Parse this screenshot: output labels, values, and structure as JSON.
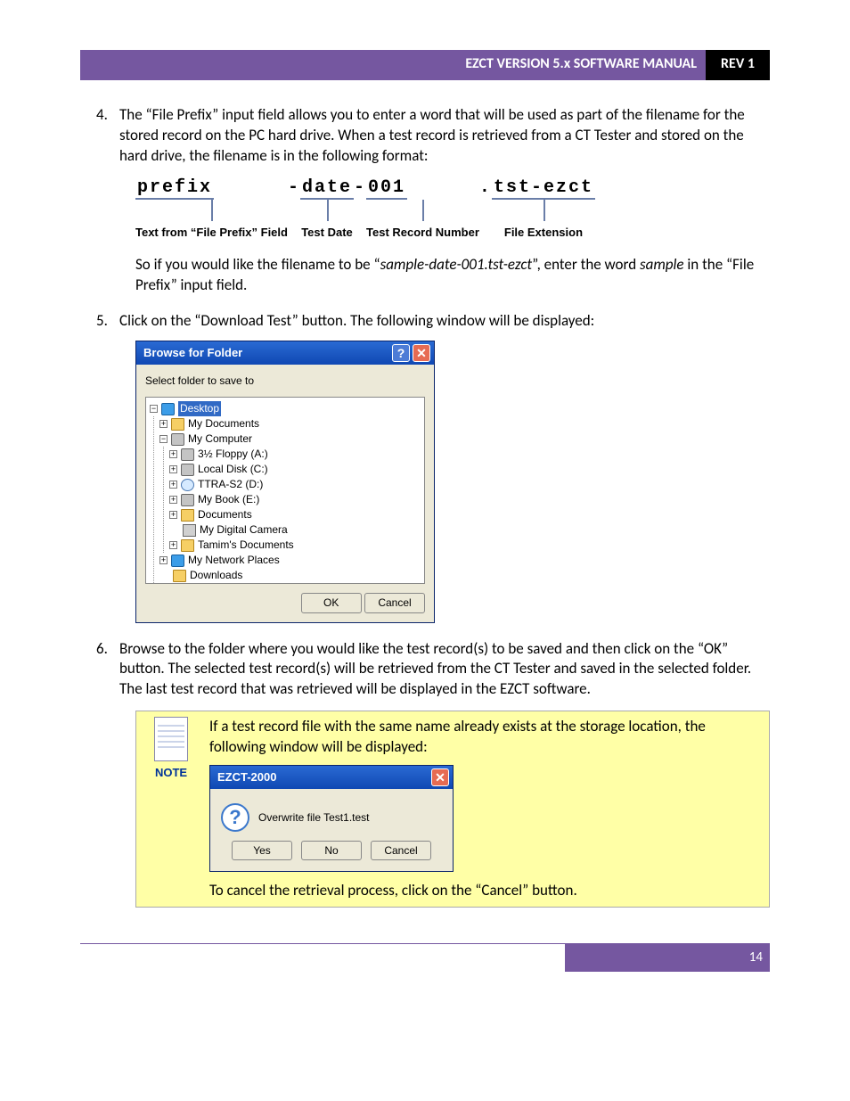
{
  "header": {
    "title": "EZCT VERSION 5.x SOFTWARE MANUAL",
    "rev": "REV 1"
  },
  "step4": {
    "num": "4.",
    "para1": "The “File Prefix” input field allows you to enter a word that will be used as part of the filename for the stored record on the PC hard drive. When a test record is retrieved from a CT Tester and stored on the hard drive, the filename is in the following format:",
    "fname": {
      "seg_prefix": "prefix",
      "dash1": "-",
      "seg_date": "date",
      "dash2": "-",
      "seg_num": "001",
      "dot": ".",
      "seg_ext": "tst-ezct",
      "lbl_prefix": "Text from “File Prefix” Field",
      "lbl_date": "Test Date",
      "lbl_num": "Test Record Number",
      "lbl_ext": "File Extension"
    },
    "para2a": "So if you would like the filename to be “",
    "para2b": "sample-date-001.tst-ezct",
    "para2c": "”, enter the word ",
    "para2d": "sample",
    "para2e": " in the “File Prefix” input field."
  },
  "step5": {
    "num": "5.",
    "text": "Click on the “Download Test” button. The following window will be displayed:"
  },
  "browse": {
    "title": "Browse for Folder",
    "subtitle": "Select folder to save to",
    "nodes": {
      "desktop": "Desktop",
      "mydocs": "My Documents",
      "mycomp": "My Computer",
      "floppy": "3½ Floppy (A:)",
      "localc": "Local Disk (C:)",
      "ttra": "TTRA-S2 (D:)",
      "mybook": "My Book (E:)",
      "documents": "Documents",
      "camera": "My Digital Camera",
      "tamim": "Tamim's Documents",
      "netplaces": "My Network Places",
      "downloads": "Downloads"
    },
    "ok": "OK",
    "cancel": "Cancel"
  },
  "step6": {
    "num": "6.",
    "text": "Browse to the folder where you would like the test record(s) to be saved and then click on the “OK” button. The selected test record(s) will be retrieved from the CT Tester and saved in the selected folder. The last test record that was retrieved will be displayed in the EZCT software."
  },
  "note": {
    "label": "NOTE",
    "line1": "If a test record file with the same name already exists at the storage location, the following window will be displayed:",
    "line2": "To cancel the retrieval process, click on the “Cancel” button."
  },
  "overwrite": {
    "title": "EZCT-2000",
    "msg": "Overwrite file Test1.test",
    "yes": "Yes",
    "no": "No",
    "cancel": "Cancel"
  },
  "footer": {
    "page": "14"
  }
}
